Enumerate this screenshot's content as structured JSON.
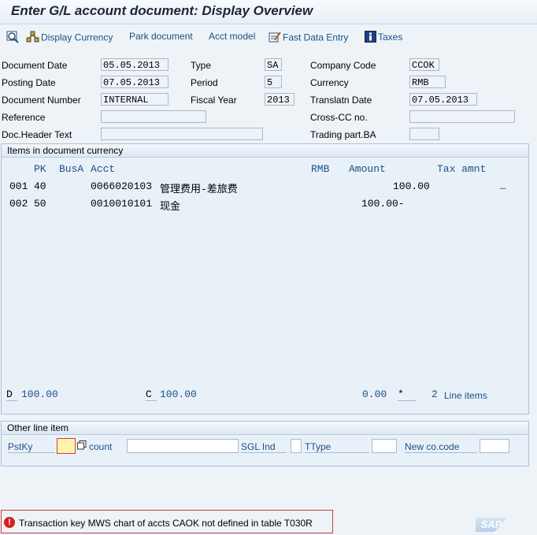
{
  "window": {
    "title": "Enter G/L account document: Display Overview"
  },
  "toolbar": {
    "display_currency": "Display Currency",
    "park_document": "Park document",
    "acct_model": "Acct model",
    "fast_data_entry": "Fast Data Entry",
    "taxes": "Taxes"
  },
  "header": {
    "document_date": {
      "label": "Document Date",
      "value": "05.05.2013"
    },
    "posting_date": {
      "label": "Posting Date",
      "value": "07.05.2013"
    },
    "document_number": {
      "label": "Document Number",
      "value": "INTERNAL"
    },
    "reference": {
      "label": "Reference",
      "value": ""
    },
    "doc_header_text": {
      "label": "Doc.Header Text",
      "value": ""
    },
    "type": {
      "label": "Type",
      "value": "SA"
    },
    "period": {
      "label": "Period",
      "value": "5"
    },
    "fiscal_year": {
      "label": "Fiscal Year",
      "value": "2013"
    },
    "company_code": {
      "label": "Company Code",
      "value": "CCOK"
    },
    "currency": {
      "label": "Currency",
      "value": "RMB"
    },
    "translatn_date": {
      "label": "Translatn Date",
      "value": "07.05.2013"
    },
    "cross_cc_no": {
      "label": "Cross-CC no.",
      "value": ""
    },
    "trading_part_ba": {
      "label": "Trading part.BA",
      "value": ""
    }
  },
  "items": {
    "title": "Items in document currency",
    "columns": {
      "pk": "PK",
      "busa": "BusA",
      "acct": "Acct",
      "rmb": "RMB",
      "amount": "Amount",
      "tax_amnt": "Tax amnt"
    },
    "rows": [
      {
        "no": "001",
        "pk": "40",
        "acct": "0066020103",
        "text": "管理费用-差旅费",
        "amount": "100.00",
        "tax": "…"
      },
      {
        "no": "002",
        "pk": "50",
        "acct": "0010010101",
        "text": "现金",
        "amount": "100.00-",
        "tax": ""
      }
    ],
    "totals": {
      "d_label": "D",
      "d_value": "100.00",
      "c_label": "C",
      "c_value": "100.00",
      "balance": "0.00",
      "star": "*",
      "line_items_count": "2",
      "line_items_label": "Line items"
    }
  },
  "other_line_item": {
    "title": "Other line item",
    "pstky_label": "PstKy",
    "pstky_value": "",
    "account_label": "count",
    "account_value": "",
    "sgl_ind_label": "SGL Ind",
    "sgl_ind_value": "",
    "ttype_label": "TType",
    "ttype_value": "",
    "new_cocode_label": "New co.code",
    "new_cocode_value": ""
  },
  "status_bar": {
    "message": "Transaction key MWS  chart of accts CAOK not defined in table T030R",
    "type": "error",
    "error_glyph": "!"
  },
  "brand": {
    "logo_text": "SAP"
  },
  "colors": {
    "link_blue": "#1d4f86",
    "error_red": "#d81e1e",
    "focus_field": "#fff3b0"
  }
}
